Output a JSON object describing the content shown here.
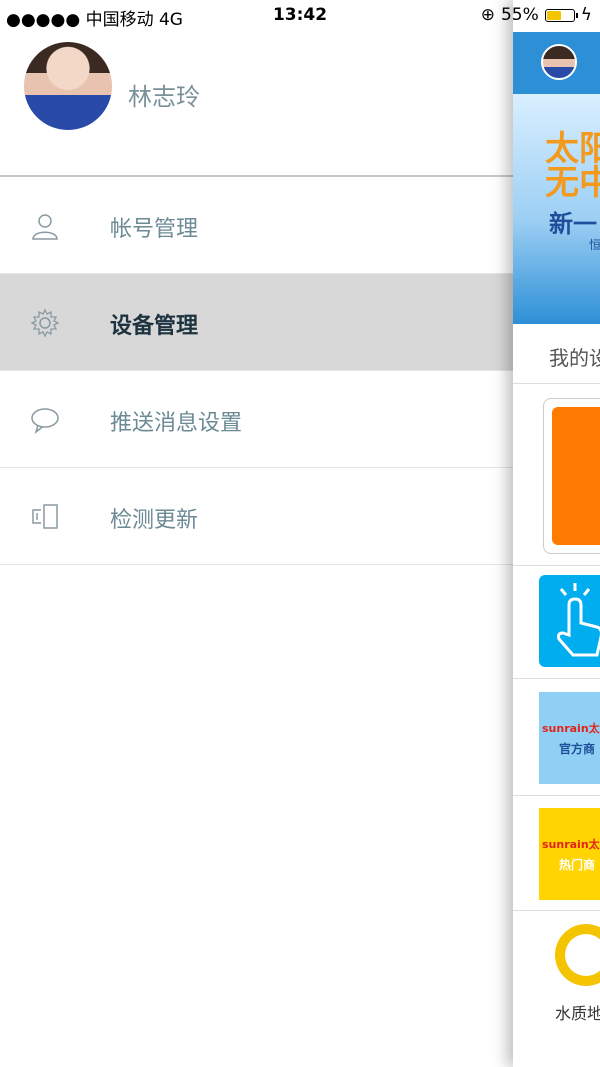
{
  "status_bar": {
    "carrier": "●●●●● 中国移动",
    "network": "4G",
    "time": "13:42",
    "battery_percent": "55%",
    "battery_level": 0.55,
    "battery_color": "#f5c400"
  },
  "profile": {
    "name": "林志玲"
  },
  "menu": {
    "items": [
      {
        "label": "帐号管理",
        "icon": "user-icon"
      },
      {
        "label": "设备管理",
        "icon": "gear-icon",
        "active": true
      },
      {
        "label": "推送消息设置",
        "icon": "chat-bubble-icon"
      },
      {
        "label": "检测更新",
        "icon": "devices-icon"
      }
    ]
  },
  "main": {
    "banner_line1": "太阳\n无中",
    "banner_line2": "新一",
    "banner_line3": "恒",
    "section_title": "我的设",
    "tile_logo": "sunrain太",
    "tile_official": "官方商",
    "tile_hot": "热门商",
    "water_map_label": "水质地"
  },
  "colors": {
    "header_blue": "#2d8fd6",
    "active_row": "#d8d8d8",
    "label_color": "#6b8a94",
    "active_label": "#1e3340"
  }
}
